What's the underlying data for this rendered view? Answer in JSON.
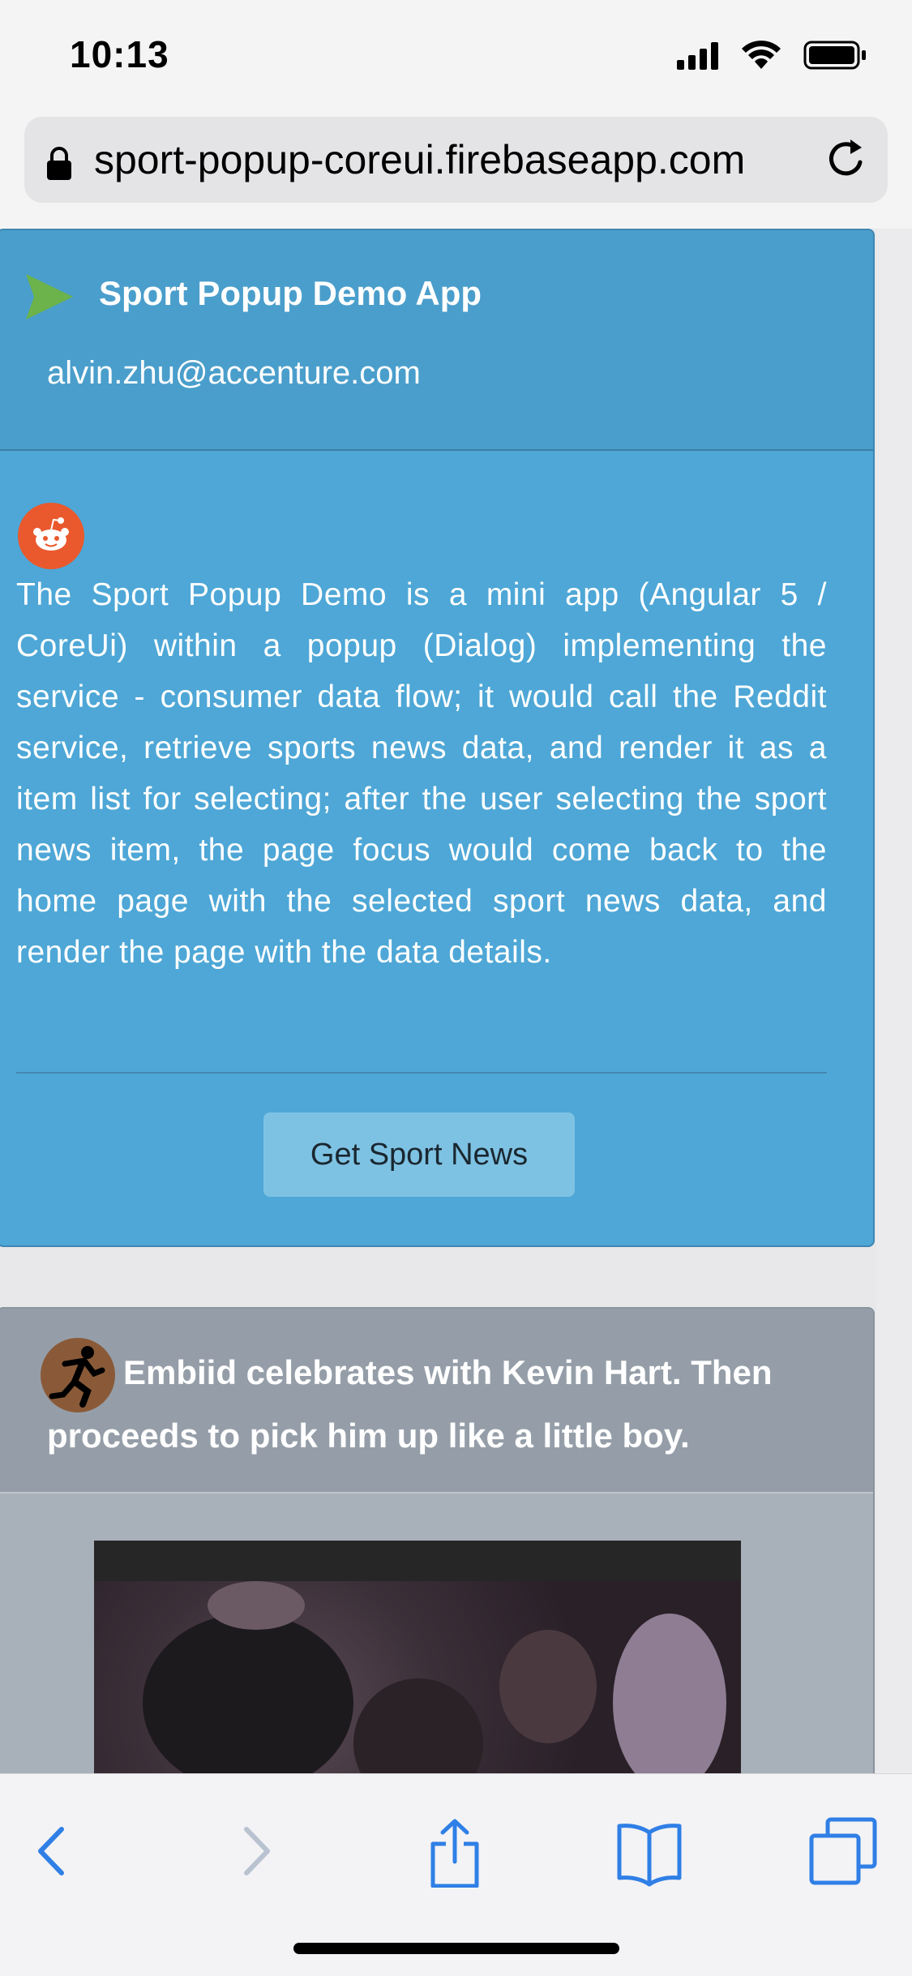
{
  "status_bar": {
    "time": "10:13"
  },
  "browser": {
    "url": "sport-popup-coreui.firebaseapp.com"
  },
  "app": {
    "title": "Sport Popup Demo App",
    "user_email": "alvin.zhu@accenture.com",
    "description": "The Sport Popup Demo is a mini app (Angular 5 / CoreUi) within a popup (Dialog) implementing the service - consumer data flow; it would call the Reddit service, retrieve sports news data, and render it as a item list for selecting; after the user selecting the sport news item, the page focus would come back to the home page with the selected sport news data, and render the page with the data details.",
    "button_label": "Get Sport News"
  },
  "news": {
    "post_title": "Embiid celebrates with Kevin Hart. Then proceeds to pick him up like a little boy."
  },
  "toolbar": {
    "items": [
      "back-icon",
      "forward-icon",
      "share-icon",
      "bookmarks-icon",
      "tabs-icon"
    ]
  },
  "colors": {
    "card_blue": "#4ea7d6",
    "header_blue": "#4a9ecb",
    "toolbar_blue": "#2f7fe6",
    "reddit_orange": "#e9592d"
  }
}
